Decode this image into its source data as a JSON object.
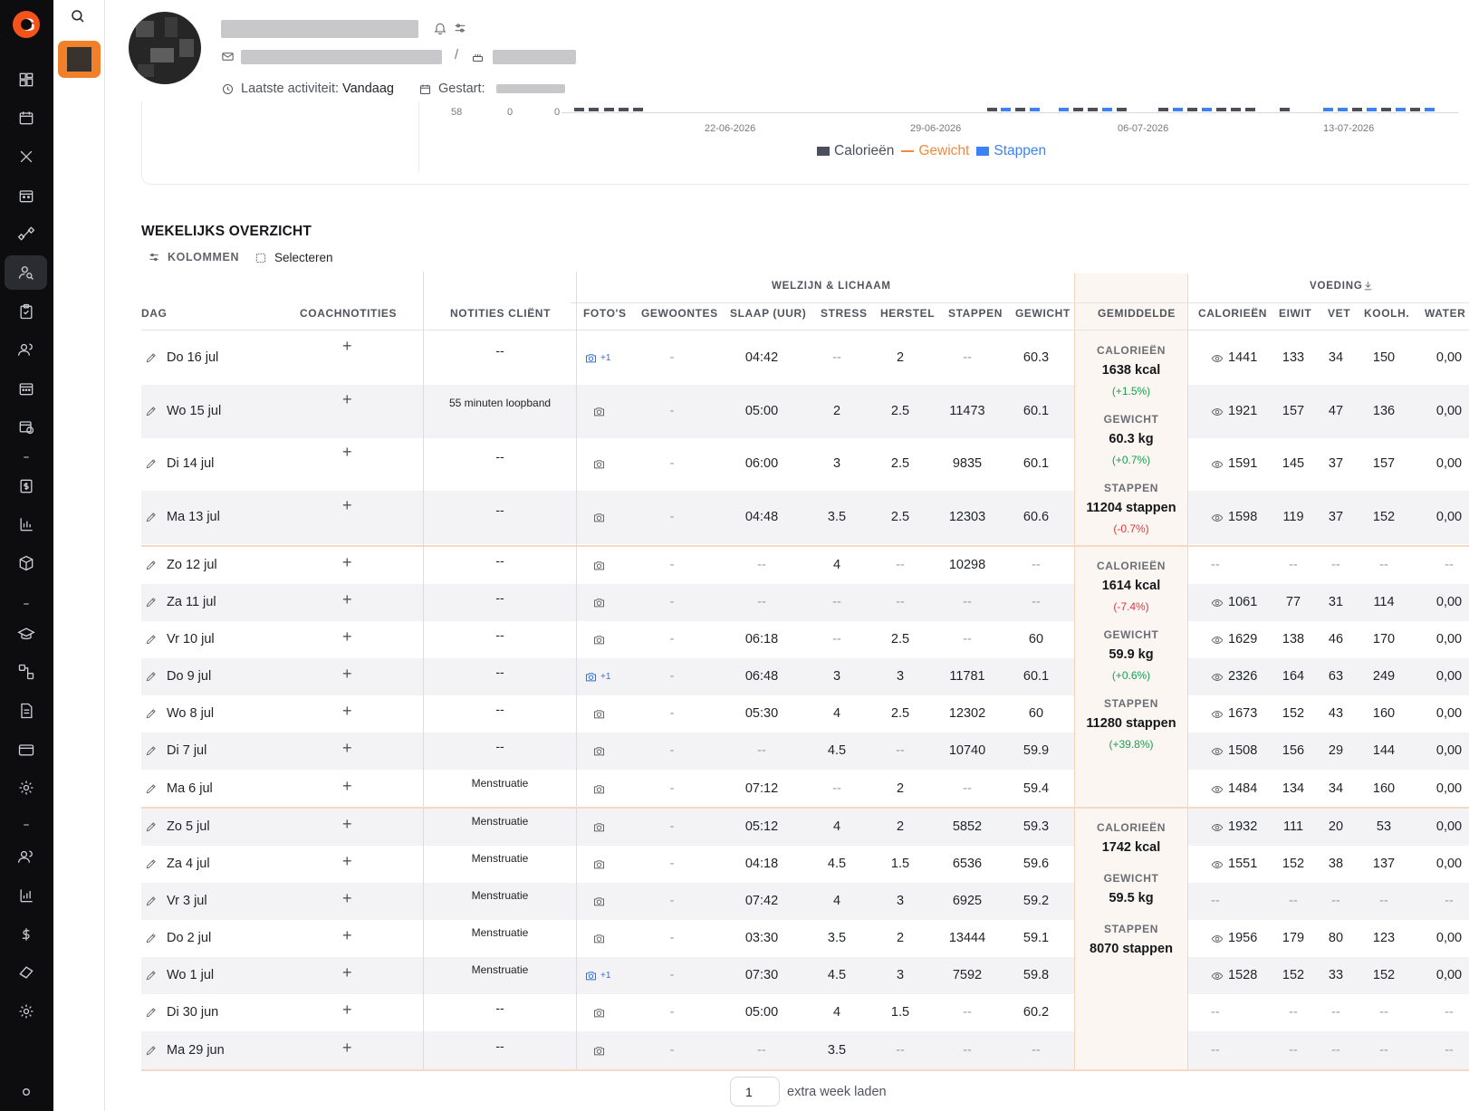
{
  "header": {
    "last_activity_label": "Laatste activiteit:",
    "last_activity_value": "Vandaag",
    "started_label": "Gestart:"
  },
  "chart": {
    "tick_left": [
      "58",
      "0",
      "0"
    ],
    "dates": [
      "22-06-2026",
      "29-06-2026",
      "06-07-2026",
      "13-07-2026"
    ],
    "legend": [
      "Calorieën",
      "Gewicht",
      "Stappen"
    ],
    "colors": {
      "calories": "#4a4f59",
      "weight": "#f08a3c",
      "steps": "#3b82f6"
    }
  },
  "weekly": {
    "title": "WEKELIJKS OVERZICHT",
    "columns_btn": "KOLOMMEN",
    "select_btn": "Selecteren",
    "group_welzijn": "WELZIJN & LICHAAM",
    "group_voeding": "VOEDING",
    "headers": {
      "dag": "DAG",
      "coach": "COACHNOTITIES",
      "client": "NOTITIES CLIËNT",
      "fotos": "FOTO'S",
      "gewoontes": "GEWOONTES",
      "slaap": "SLAAP (UUR)",
      "stress": "STRESS",
      "herstel": "HERSTEL",
      "stappen": "STAPPEN",
      "gewicht": "GEWICHT",
      "gem": "GEMIDDELDE",
      "cal": "CALORIEËN",
      "eiwit": "EIWIT",
      "vet": "VET",
      "koolh": "KOOLH.",
      "water": "WATER"
    },
    "rows": [
      {
        "day": "Do 16 jul",
        "note": "--",
        "photo": "blue",
        "hab": "-",
        "sleep": "04:42",
        "stress": "--",
        "herstel": "2",
        "steps": "--",
        "weight": "60.3",
        "cal": "1441",
        "eiwit": "133",
        "vet": "34",
        "koolh": "150",
        "water": "0,00"
      },
      {
        "day": "Wo 15 jul",
        "note": "55 minuten loopband",
        "photo": "grey",
        "hab": "-",
        "sleep": "05:00",
        "stress": "2",
        "herstel": "2.5",
        "steps": "11473",
        "weight": "60.1",
        "cal": "1921",
        "eiwit": "157",
        "vet": "47",
        "koolh": "136",
        "water": "0,00"
      },
      {
        "day": "Di 14 jul",
        "note": "--",
        "photo": "grey",
        "hab": "-",
        "sleep": "06:00",
        "stress": "3",
        "herstel": "2.5",
        "steps": "9835",
        "weight": "60.1",
        "cal": "1591",
        "eiwit": "145",
        "vet": "37",
        "koolh": "157",
        "water": "0,00"
      },
      {
        "day": "Ma 13 jul",
        "note": "--",
        "photo": "grey",
        "hab": "-",
        "sleep": "04:48",
        "stress": "3.5",
        "herstel": "2.5",
        "steps": "12303",
        "weight": "60.6",
        "cal": "1598",
        "eiwit": "119",
        "vet": "37",
        "koolh": "152",
        "water": "0,00"
      },
      {
        "day": "Zo 12 jul",
        "note": "--",
        "photo": "grey",
        "hab": "-",
        "sleep": "--",
        "stress": "4",
        "herstel": "--",
        "steps": "10298",
        "weight": "--",
        "cal": "--",
        "eiwit": "--",
        "vet": "--",
        "koolh": "--",
        "water": "--"
      },
      {
        "day": "Za 11 jul",
        "note": "--",
        "photo": "grey",
        "hab": "-",
        "sleep": "--",
        "stress": "--",
        "herstel": "--",
        "steps": "--",
        "weight": "--",
        "cal": "1061",
        "eiwit": "77",
        "vet": "31",
        "koolh": "114",
        "water": "0,00"
      },
      {
        "day": "Vr 10 jul",
        "note": "--",
        "photo": "grey",
        "hab": "-",
        "sleep": "06:18",
        "stress": "--",
        "herstel": "2.5",
        "steps": "--",
        "weight": "60",
        "cal": "1629",
        "eiwit": "138",
        "vet": "46",
        "koolh": "170",
        "water": "0,00"
      },
      {
        "day": "Do 9 jul",
        "note": "--",
        "photo": "blue",
        "hab": "-",
        "sleep": "06:48",
        "stress": "3",
        "herstel": "3",
        "steps": "11781",
        "weight": "60.1",
        "cal": "2326",
        "eiwit": "164",
        "vet": "63",
        "koolh": "249",
        "water": "0,00"
      },
      {
        "day": "Wo 8 jul",
        "note": "--",
        "photo": "grey",
        "hab": "-",
        "sleep": "05:30",
        "stress": "4",
        "herstel": "2.5",
        "steps": "12302",
        "weight": "60",
        "cal": "1673",
        "eiwit": "152",
        "vet": "43",
        "koolh": "160",
        "water": "0,00"
      },
      {
        "day": "Di 7 jul",
        "note": "--",
        "photo": "grey",
        "hab": "-",
        "sleep": "--",
        "stress": "4.5",
        "herstel": "--",
        "steps": "10740",
        "weight": "59.9",
        "cal": "1508",
        "eiwit": "156",
        "vet": "29",
        "koolh": "144",
        "water": "0,00"
      },
      {
        "day": "Ma 6 jul",
        "note": "Menstruatie",
        "photo": "grey",
        "hab": "-",
        "sleep": "07:12",
        "stress": "--",
        "herstel": "2",
        "steps": "--",
        "weight": "59.4",
        "cal": "1484",
        "eiwit": "134",
        "vet": "34",
        "koolh": "160",
        "water": "0,00"
      },
      {
        "day": "Zo 5 jul",
        "note": "Menstruatie",
        "photo": "grey",
        "hab": "-",
        "sleep": "05:12",
        "stress": "4",
        "herstel": "2",
        "steps": "5852",
        "weight": "59.3",
        "cal": "1932",
        "eiwit": "111",
        "vet": "20",
        "koolh": "53",
        "water": "0,00"
      },
      {
        "day": "Za 4 jul",
        "note": "Menstruatie",
        "photo": "grey",
        "hab": "-",
        "sleep": "04:18",
        "stress": "4.5",
        "herstel": "1.5",
        "steps": "6536",
        "weight": "59.6",
        "cal": "1551",
        "eiwit": "152",
        "vet": "38",
        "koolh": "137",
        "water": "0,00"
      },
      {
        "day": "Vr 3 jul",
        "note": "Menstruatie",
        "photo": "grey",
        "hab": "-",
        "sleep": "07:42",
        "stress": "4",
        "herstel": "3",
        "steps": "6925",
        "weight": "59.2",
        "cal": "--",
        "eiwit": "--",
        "vet": "--",
        "koolh": "--",
        "water": "--"
      },
      {
        "day": "Do 2 jul",
        "note": "Menstruatie",
        "photo": "grey",
        "hab": "-",
        "sleep": "03:30",
        "stress": "3.5",
        "herstel": "2",
        "steps": "13444",
        "weight": "59.1",
        "cal": "1956",
        "eiwit": "179",
        "vet": "80",
        "koolh": "123",
        "water": "0,00"
      },
      {
        "day": "Wo 1 jul",
        "note": "Menstruatie",
        "photo": "blue",
        "hab": "-",
        "sleep": "07:30",
        "stress": "4.5",
        "herstel": "3",
        "steps": "7592",
        "weight": "59.8",
        "cal": "1528",
        "eiwit": "152",
        "vet": "33",
        "koolh": "152",
        "water": "0,00"
      },
      {
        "day": "Di 30 jun",
        "note": "--",
        "photo": "grey",
        "hab": "-",
        "sleep": "05:00",
        "stress": "4",
        "herstel": "1.5",
        "steps": "--",
        "weight": "60.2",
        "cal": "--",
        "eiwit": "--",
        "vet": "--",
        "koolh": "--",
        "water": "--"
      },
      {
        "day": "Ma 29 jun",
        "note": "--",
        "photo": "grey",
        "hab": "-",
        "sleep": "--",
        "stress": "3.5",
        "herstel": "--",
        "steps": "--",
        "weight": "--",
        "cal": "--",
        "eiwit": "--",
        "vet": "--",
        "koolh": "--",
        "water": "--"
      }
    ],
    "averages": [
      {
        "cal_label": "CALORIEËN",
        "cal": "1638 kcal",
        "cal_pct": "(+1.5%)",
        "cal_dir": "up",
        "w_label": "GEWICHT",
        "w": "60.3 kg",
        "w_pct": "(+0.7%)",
        "w_dir": "up",
        "s_label": "STAPPEN",
        "s": "11204 stappen",
        "s_pct": "(-0.7%)",
        "s_dir": "down"
      },
      {
        "cal_label": "CALORIEËN",
        "cal": "1614 kcal",
        "cal_pct": "(-7.4%)",
        "cal_dir": "down",
        "w_label": "GEWICHT",
        "w": "59.9 kg",
        "w_pct": "(+0.6%)",
        "w_dir": "up",
        "s_label": "STAPPEN",
        "s": "11280 stappen",
        "s_pct": "(+39.8%)",
        "s_dir": "up"
      },
      {
        "cal_label": "CALORIEËN",
        "cal": "1742 kcal",
        "cal_pct": "",
        "cal_dir": "",
        "w_label": "GEWICHT",
        "w": "59.5 kg",
        "w_pct": "",
        "w_dir": "",
        "s_label": "STAPPEN",
        "s": "8070 stappen",
        "s_pct": "",
        "s_dir": ""
      }
    ],
    "photo_extra": "+1",
    "load_value": "1",
    "load_label": "extra week laden"
  }
}
